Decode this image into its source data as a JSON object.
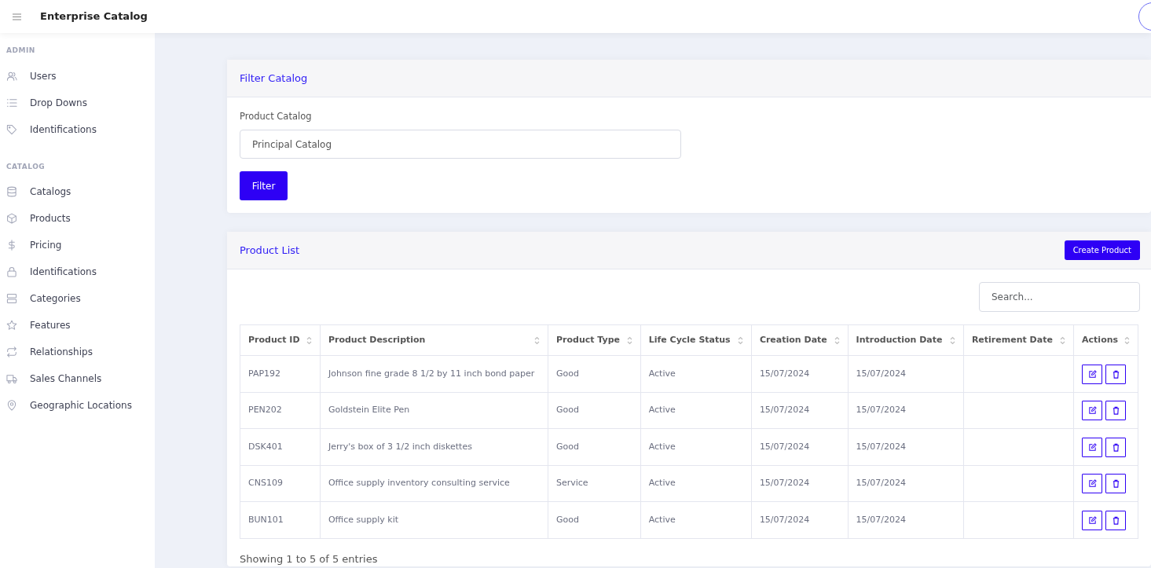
{
  "app": {
    "title": "Enterprise Catalog"
  },
  "sidebar": {
    "sections": [
      {
        "heading": "ADMIN",
        "items": [
          {
            "label": "Users"
          },
          {
            "label": "Drop Downs"
          },
          {
            "label": "Identifications"
          }
        ]
      },
      {
        "heading": "CATALOG",
        "items": [
          {
            "label": "Catalogs"
          },
          {
            "label": "Products"
          },
          {
            "label": "Pricing"
          },
          {
            "label": "Identifications"
          },
          {
            "label": "Categories"
          },
          {
            "label": "Features"
          },
          {
            "label": "Relationships"
          },
          {
            "label": "Sales Channels"
          },
          {
            "label": "Geographic Locations"
          }
        ]
      }
    ]
  },
  "filter_card": {
    "title": "Filter Catalog",
    "field_label": "Product Catalog",
    "field_value": "Principal Catalog",
    "button": "Filter"
  },
  "product_card": {
    "title": "Product List",
    "create_button": "Create Product",
    "search": {
      "placeholder": "Search..."
    },
    "table": {
      "columns": [
        "Product ID",
        "Product Description",
        "Product Type",
        "Life Cycle Status",
        "Creation Date",
        "Introduction Date",
        "Retirement Date",
        "Actions"
      ],
      "rows": [
        [
          "PAP192",
          "Johnson fine grade 8 1/2 by 11 inch bond paper",
          "Good",
          "Active",
          "15/07/2024",
          "15/07/2024",
          ""
        ],
        [
          "PEN202",
          "Goldstein Elite Pen",
          "Good",
          "Active",
          "15/07/2024",
          "15/07/2024",
          ""
        ],
        [
          "DSK401",
          "Jerry's box of 3 1/2 inch diskettes",
          "Good",
          "Active",
          "15/07/2024",
          "15/07/2024",
          ""
        ],
        [
          "CNS109",
          "Office supply inventory consulting service",
          "Service",
          "Active",
          "15/07/2024",
          "15/07/2024",
          ""
        ],
        [
          "BUN101",
          "Office supply kit",
          "Good",
          "Active",
          "15/07/2024",
          "15/07/2024",
          ""
        ]
      ]
    },
    "footer": "Showing 1 to 5 of 5 entries"
  }
}
